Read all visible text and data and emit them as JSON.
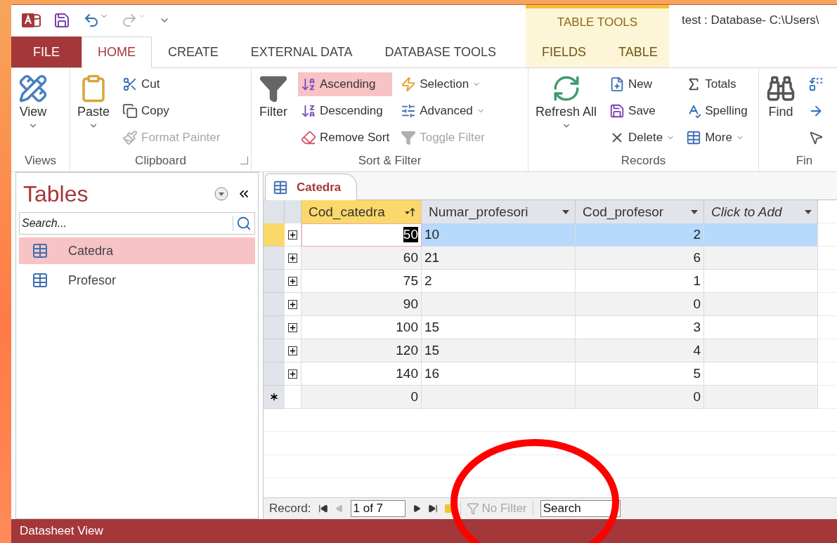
{
  "title_bar": {
    "context_group": "TABLE TOOLS",
    "title": "test : Database- C:\\Users\\"
  },
  "tabs": [
    {
      "label": "FILE",
      "kind": "file",
      "selected": false
    },
    {
      "label": "HOME",
      "kind": "normal",
      "selected": true
    },
    {
      "label": "CREATE",
      "kind": "normal",
      "selected": false
    },
    {
      "label": "EXTERNAL DATA",
      "kind": "normal",
      "selected": false
    },
    {
      "label": "DATABASE TOOLS",
      "kind": "normal",
      "selected": false
    },
    {
      "label": "FIELDS",
      "kind": "contextual",
      "selected": false
    },
    {
      "label": "TABLE",
      "kind": "contextual",
      "selected": false
    }
  ],
  "ribbon": [
    {
      "label": "Views",
      "launcher": false,
      "large": [
        {
          "label": "View",
          "dropdown": true
        }
      ]
    },
    {
      "label": "Clipboard",
      "launcher": true,
      "large": [
        {
          "label": "Paste",
          "dropdown": true
        }
      ],
      "columns": [
        [
          {
            "label": "Cut",
            "dropdown": false,
            "disabled": false,
            "selected": false
          },
          {
            "label": "Copy",
            "dropdown": false,
            "disabled": false,
            "selected": false
          },
          {
            "label": "Format Painter",
            "dropdown": false,
            "disabled": true,
            "selected": false
          }
        ]
      ]
    },
    {
      "label": "Sort & Filter",
      "launcher": false,
      "large": [
        {
          "label": "Filter",
          "dropdown": false
        }
      ],
      "columns": [
        [
          {
            "label": "Ascending",
            "dropdown": false,
            "disabled": false,
            "selected": true
          },
          {
            "label": "Descending",
            "dropdown": false,
            "disabled": false,
            "selected": false
          },
          {
            "label": "Remove Sort",
            "dropdown": false,
            "disabled": false,
            "selected": false
          }
        ],
        [
          {
            "label": "Selection",
            "dropdown": true,
            "disabled": false,
            "selected": false
          },
          {
            "label": "Advanced",
            "dropdown": true,
            "disabled": false,
            "selected": false
          },
          {
            "label": "Toggle Filter",
            "dropdown": false,
            "disabled": true,
            "selected": false
          }
        ]
      ]
    },
    {
      "label": "Records",
      "launcher": false,
      "large": [
        {
          "label": "Refresh All",
          "dropdown": true
        }
      ],
      "columns": [
        [
          {
            "label": "New",
            "dropdown": false,
            "disabled": false,
            "selected": false
          },
          {
            "label": "Save",
            "dropdown": false,
            "disabled": false,
            "selected": false
          },
          {
            "label": "Delete",
            "dropdown": true,
            "disabled": false,
            "selected": false
          }
        ],
        [
          {
            "label": "Totals",
            "dropdown": false,
            "disabled": false,
            "selected": false
          },
          {
            "label": "Spelling",
            "dropdown": false,
            "disabled": false,
            "selected": false
          },
          {
            "label": "More",
            "dropdown": true,
            "disabled": false,
            "selected": false
          }
        ]
      ]
    },
    {
      "label": "Fin",
      "large": [
        {
          "label": "Find",
          "dropdown": false
        }
      ],
      "columns": [
        [
          {
            "dropdown": false,
            "selected": false
          },
          {
            "dropdown": false,
            "selected": false
          },
          {
            "dropdown": false,
            "selected": false
          }
        ]
      ]
    }
  ],
  "nav_pane": {
    "title": "Tables",
    "search": {
      "placeholder": "Search..."
    },
    "items": [
      {
        "label": "Catedra",
        "selected": true
      },
      {
        "label": "Profesor",
        "selected": false
      }
    ]
  },
  "document_tab": "Catedra",
  "table": {
    "columns": [
      {
        "label": "Cod_catedra",
        "sorted": true,
        "italic": false
      },
      {
        "label": "Numar_profesori",
        "sorted": false,
        "italic": false
      },
      {
        "label": "Cod_profesor",
        "sorted": false,
        "italic": false
      },
      {
        "label": "Click to Add",
        "sorted": false,
        "italic": true
      }
    ],
    "rows": [
      {
        "selected": true,
        "cells": [
          {
            "value": "50"
          },
          {
            "value": "10"
          },
          {
            "value": "2"
          }
        ]
      },
      {
        "selected": false,
        "cells": [
          {
            "value": "60"
          },
          {
            "value": "21"
          },
          {
            "value": "6"
          }
        ]
      },
      {
        "selected": false,
        "cells": [
          {
            "value": "75"
          },
          {
            "value": "2"
          },
          {
            "value": "1"
          }
        ]
      },
      {
        "selected": false,
        "cells": [
          {
            "value": "90"
          },
          {},
          {
            "value": "0"
          }
        ]
      },
      {
        "selected": false,
        "cells": [
          {
            "value": "100"
          },
          {
            "value": "15"
          },
          {
            "value": "3"
          }
        ]
      },
      {
        "selected": false,
        "cells": [
          {
            "value": "120"
          },
          {
            "value": "15"
          },
          {
            "value": "4"
          }
        ]
      },
      {
        "selected": false,
        "cells": [
          {
            "value": "140"
          },
          {
            "value": "16"
          },
          {
            "value": "5"
          }
        ]
      }
    ],
    "new_row": {
      "cells": [
        {
          "value": "0"
        },
        {},
        {
          "value": "0"
        }
      ]
    }
  },
  "record_nav": {
    "label": "Record:",
    "position": "1 of 7",
    "filter": "No Filter",
    "search": "Search"
  },
  "status_bar": "Datasheet View"
}
